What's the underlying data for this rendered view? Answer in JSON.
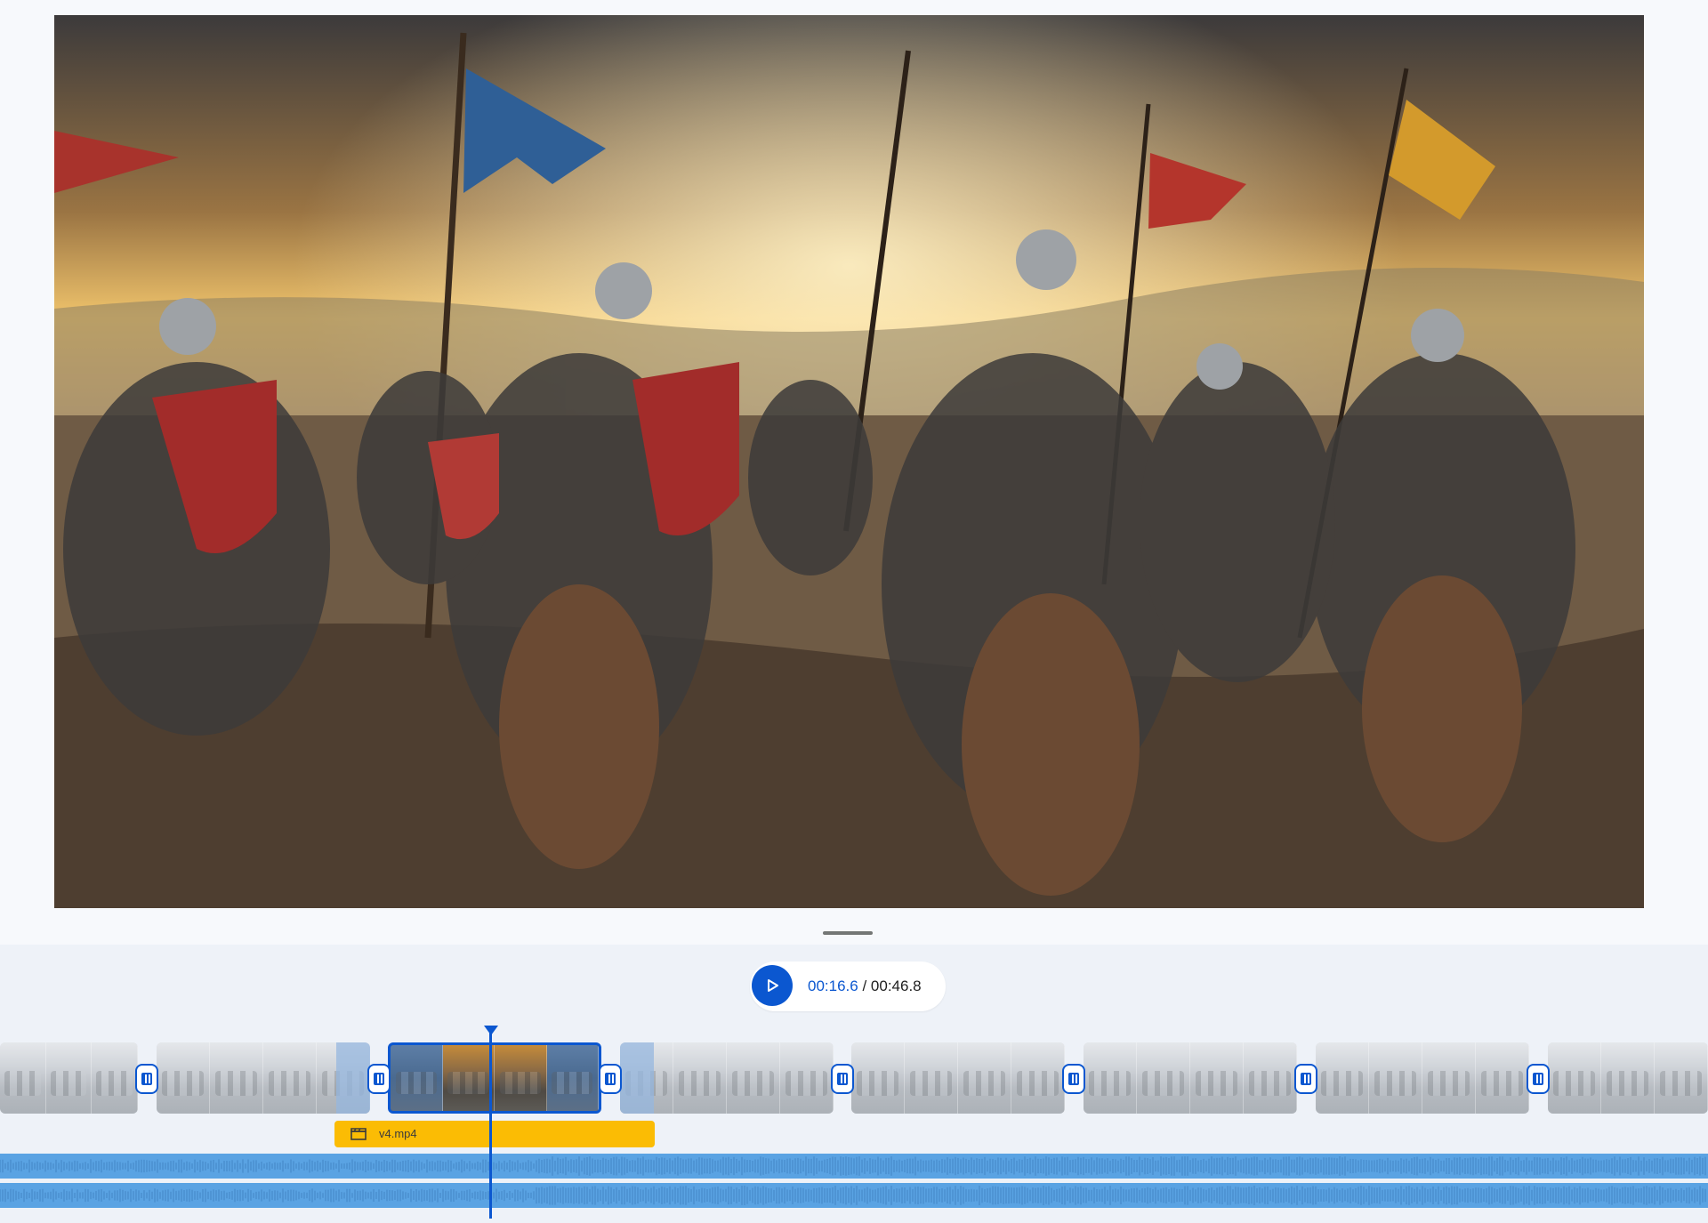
{
  "preview": {
    "description_icon": "video-frame",
    "colors": {
      "sky": "#d9a54b",
      "ground": "#7d6850"
    }
  },
  "transport": {
    "play_icon": "play-icon",
    "current_time": "00:16.6",
    "separator": " / ",
    "total_time": "00:46.8"
  },
  "timeline": {
    "clips": [
      {
        "id": "clip-1",
        "thumbs": 3,
        "state": "dim"
      },
      {
        "id": "clip-2",
        "thumbs": 4,
        "state": "dim"
      },
      {
        "id": "clip-3",
        "thumbs": 4,
        "state": "selected"
      },
      {
        "id": "clip-4",
        "thumbs": 4,
        "state": "dim"
      },
      {
        "id": "clip-5",
        "thumbs": 4,
        "state": "dim"
      },
      {
        "id": "clip-6",
        "thumbs": 4,
        "state": "dim"
      },
      {
        "id": "clip-7",
        "thumbs": 4,
        "state": "dim"
      },
      {
        "id": "clip-8",
        "thumbs": 3,
        "state": "dim"
      }
    ],
    "media_track": {
      "icon": "clapperboard-icon",
      "label": "v4.mp4"
    },
    "colors": {
      "accent": "#0b57d0",
      "media": "#fbbc04",
      "audio": "#5aa3e3"
    }
  }
}
